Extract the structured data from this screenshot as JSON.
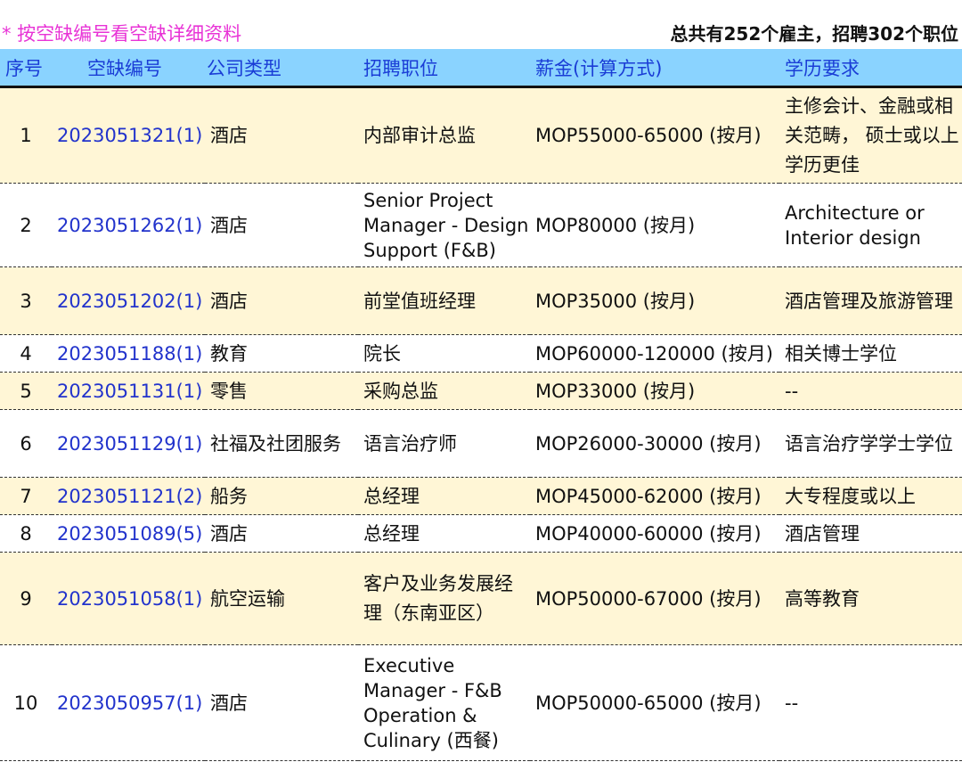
{
  "header": {
    "hint": "* 按空缺编号看空缺详细资料",
    "summary": "总共有252个雇主，招聘302个职位"
  },
  "columns": [
    "序号",
    "空缺编号",
    "公司类型",
    "招聘职位",
    "薪金(计算方式)",
    "学历要求"
  ],
  "rows": [
    {
      "no": "1",
      "code": "2023051321(1)",
      "type": "酒店",
      "position": "内部审计总监",
      "salary": "MOP55000-65000 (按月)",
      "education": "主修会计、金融或相关范畴， 硕士或以上学历更佳"
    },
    {
      "no": "2",
      "code": "2023051262(1)",
      "type": "酒店",
      "position": "Senior Project Manager - Design Support (F&B)",
      "salary": "MOP80000 (按月)",
      "education": "Architecture or Interior design"
    },
    {
      "no": "3",
      "code": "2023051202(1)",
      "type": "酒店",
      "position": "前堂值班经理",
      "salary": "MOP35000 (按月)",
      "education": "酒店管理及旅游管理"
    },
    {
      "no": "4",
      "code": "2023051188(1)",
      "type": "教育",
      "position": "院长",
      "salary": "MOP60000-120000 (按月)",
      "education": "相关博士学位"
    },
    {
      "no": "5",
      "code": "2023051131(1)",
      "type": "零售",
      "position": "采购总监",
      "salary": "MOP33000 (按月)",
      "education": "--"
    },
    {
      "no": "6",
      "code": "2023051129(1)",
      "type": "社福及社团服务",
      "position": "语言治疗师",
      "salary": "MOP26000-30000 (按月)",
      "education": "语言治疗学学士学位"
    },
    {
      "no": "7",
      "code": "2023051121(2)",
      "type": "船务",
      "position": "总经理",
      "salary": "MOP45000-62000 (按月)",
      "education": "大专程度或以上"
    },
    {
      "no": "8",
      "code": "2023051089(5)",
      "type": "酒店",
      "position": "总经理",
      "salary": "MOP40000-60000 (按月)",
      "education": "酒店管理"
    },
    {
      "no": "9",
      "code": "2023051058(1)",
      "type": "航空运输",
      "position": "客户及业务发展经理（东南亚区）",
      "salary": "MOP50000-67000 (按月)",
      "education": "高等教育"
    },
    {
      "no": "10",
      "code": "2023050957(1)",
      "type": "酒店",
      "position": "Executive Manager - F&B Operation & Culinary (西餐)",
      "salary": "MOP50000-65000 (按月)",
      "education": "--"
    }
  ]
}
